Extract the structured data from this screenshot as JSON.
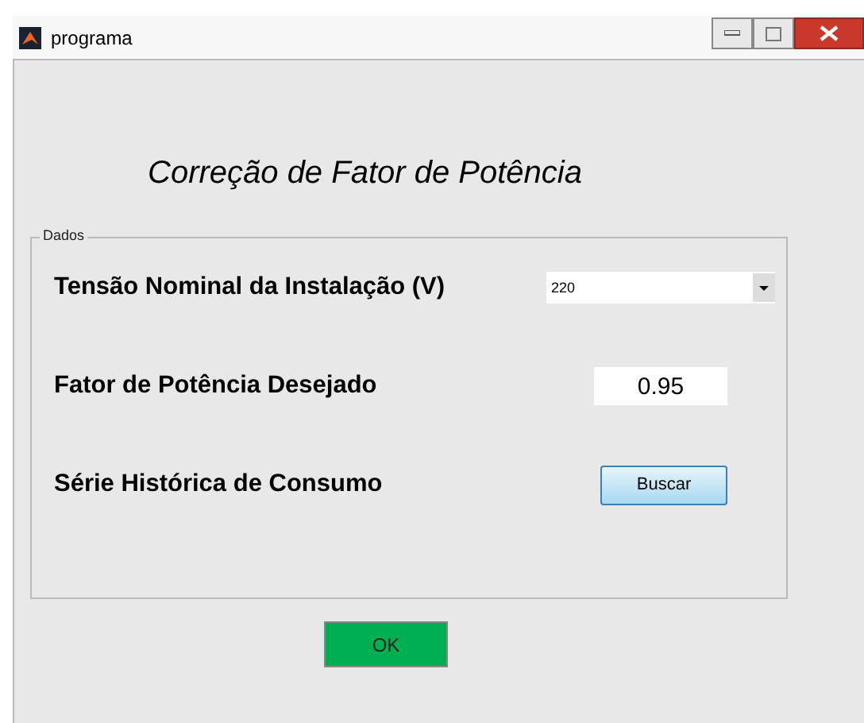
{
  "window": {
    "title": "programa"
  },
  "heading": "Correção de Fator de Potência",
  "panel": {
    "title": "Dados",
    "rows": [
      {
        "kind": "dropdown",
        "label": "Tensão Nominal da Instalação (V)",
        "value": "220"
      },
      {
        "kind": "field",
        "label": "Fator de Potência Desejado",
        "value": "0.95"
      },
      {
        "kind": "button",
        "label": "Série Histórica de Consumo",
        "button": "Buscar"
      }
    ]
  },
  "ok_button": "OK"
}
